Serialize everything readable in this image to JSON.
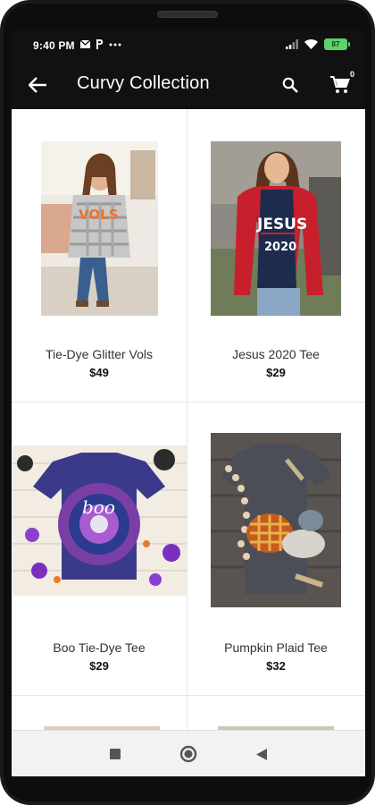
{
  "status": {
    "time": "9:40 PM",
    "notification_icons": [
      "mail-icon",
      "p-icon",
      "more-icon"
    ],
    "battery": "87"
  },
  "appbar": {
    "title": "Curvy Collection",
    "cart_count": "0"
  },
  "products": [
    {
      "name": "Tie-Dye Glitter Vols",
      "price": "$49"
    },
    {
      "name": "Jesus 2020 Tee",
      "price": "$29"
    },
    {
      "name": "Boo Tie-Dye Tee",
      "price": "$29"
    },
    {
      "name": "Pumpkin Plaid Tee",
      "price": "$32"
    }
  ],
  "colors": {
    "appbar": "#111111",
    "battery": "#5fd16b"
  }
}
